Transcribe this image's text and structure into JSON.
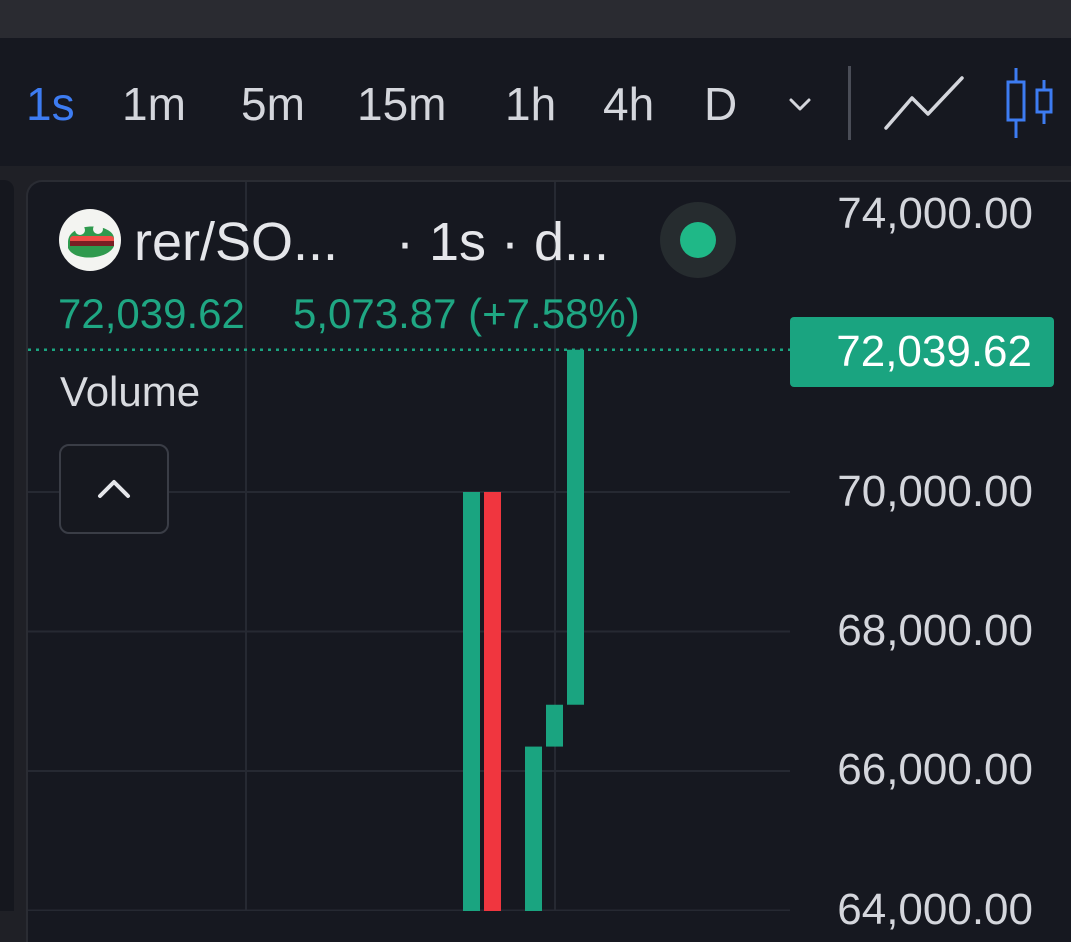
{
  "toolbar": {
    "timeframes": [
      {
        "label": "1s",
        "active": true
      },
      {
        "label": "1m",
        "active": false
      },
      {
        "label": "5m",
        "active": false
      },
      {
        "label": "15m",
        "active": false
      },
      {
        "label": "1h",
        "active": false
      },
      {
        "label": "4h",
        "active": false
      },
      {
        "label": "D",
        "active": false
      }
    ],
    "more_icon": "chevron-down-icon",
    "chart_type_icons": [
      "line-chart-icon",
      "candlestick-icon"
    ]
  },
  "legend": {
    "symbol": "rer/SO...",
    "interval": "· 1s · d...",
    "last_price": "72,039.62",
    "change": "5,073.87 (+7.58%)",
    "status": "market-open-dot"
  },
  "volume": {
    "label": "Volume",
    "collapse_icon": "chevron-up-icon"
  },
  "price_axis": {
    "labels": [
      "74,000.00",
      "70,000.00",
      "68,000.00",
      "66,000.00",
      "64,000.00"
    ],
    "last_price_tag": "72,039.62"
  },
  "colors": {
    "up": "#1aa480",
    "down": "#f0363f",
    "active_tab": "#3d7cf2",
    "background": "#161820"
  },
  "chart_data": {
    "type": "candlestick",
    "y_axis_ticks": [
      74000,
      70000,
      68000,
      66000,
      64000
    ],
    "last_price": 72039.62,
    "candles": [
      {
        "open": 63000,
        "close": 70000,
        "direction": "up"
      },
      {
        "open": 70000,
        "close": 63000,
        "direction": "down"
      },
      {
        "open": 63000,
        "close": 66350,
        "direction": "up"
      },
      {
        "open": 66350,
        "close": 66950,
        "direction": "up"
      },
      {
        "open": 66950,
        "close": 72039.62,
        "direction": "up"
      }
    ]
  }
}
